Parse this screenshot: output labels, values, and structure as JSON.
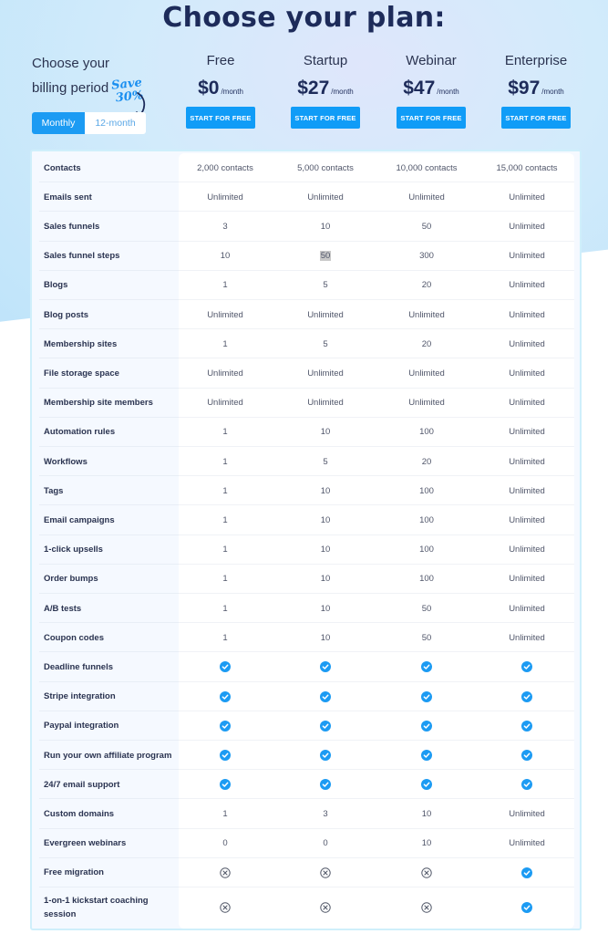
{
  "title": "Choose your plan:",
  "billing": {
    "label_line1": "Choose your",
    "label_line2": "billing period",
    "save_note_line1": "Save",
    "save_note_line2": "30%",
    "options": [
      "Monthly",
      "12-month"
    ],
    "selected": "Monthly"
  },
  "colors": {
    "accent": "#109cf7",
    "heading": "#1d2b5a",
    "check": "#1c9bf3"
  },
  "plans": [
    {
      "name": "Free",
      "price": "$0",
      "period": "/month",
      "button": "START FOR FREE"
    },
    {
      "name": "Startup",
      "price": "$27",
      "period": "/month",
      "button": "START FOR FREE"
    },
    {
      "name": "Webinar",
      "price": "$47",
      "period": "/month",
      "button": "START FOR FREE"
    },
    {
      "name": "Enterprise",
      "price": "$97",
      "period": "/month",
      "button": "START FOR FREE"
    }
  ],
  "features": [
    {
      "label": "Contacts",
      "values": [
        "2,000 contacts",
        "5,000 contacts",
        "10,000 contacts",
        "15,000 contacts"
      ]
    },
    {
      "label": "Emails sent",
      "values": [
        "Unlimited",
        "Unlimited",
        "Unlimited",
        "Unlimited"
      ]
    },
    {
      "label": "Sales funnels",
      "values": [
        "3",
        "10",
        "50",
        "Unlimited"
      ]
    },
    {
      "label": "Sales funnel steps",
      "values": [
        "10",
        "50",
        "300",
        "Unlimited"
      ],
      "selected_cell": 1
    },
    {
      "label": "Blogs",
      "values": [
        "1",
        "5",
        "20",
        "Unlimited"
      ]
    },
    {
      "label": "Blog posts",
      "values": [
        "Unlimited",
        "Unlimited",
        "Unlimited",
        "Unlimited"
      ]
    },
    {
      "label": "Membership sites",
      "values": [
        "1",
        "5",
        "20",
        "Unlimited"
      ]
    },
    {
      "label": "File storage space",
      "values": [
        "Unlimited",
        "Unlimited",
        "Unlimited",
        "Unlimited"
      ]
    },
    {
      "label": "Membership site members",
      "values": [
        "Unlimited",
        "Unlimited",
        "Unlimited",
        "Unlimited"
      ]
    },
    {
      "label": "Automation rules",
      "values": [
        "1",
        "10",
        "100",
        "Unlimited"
      ]
    },
    {
      "label": "Workflows",
      "values": [
        "1",
        "5",
        "20",
        "Unlimited"
      ]
    },
    {
      "label": "Tags",
      "values": [
        "1",
        "10",
        "100",
        "Unlimited"
      ]
    },
    {
      "label": "Email campaigns",
      "values": [
        "1",
        "10",
        "100",
        "Unlimited"
      ]
    },
    {
      "label": "1-click upsells",
      "values": [
        "1",
        "10",
        "100",
        "Unlimited"
      ]
    },
    {
      "label": "Order bumps",
      "values": [
        "1",
        "10",
        "100",
        "Unlimited"
      ]
    },
    {
      "label": "A/B tests",
      "values": [
        "1",
        "10",
        "50",
        "Unlimited"
      ]
    },
    {
      "label": "Coupon codes",
      "values": [
        "1",
        "10",
        "50",
        "Unlimited"
      ]
    },
    {
      "label": "Deadline funnels",
      "values": [
        "check",
        "check",
        "check",
        "check"
      ]
    },
    {
      "label": "Stripe integration",
      "values": [
        "check",
        "check",
        "check",
        "check"
      ]
    },
    {
      "label": "Paypal integration",
      "values": [
        "check",
        "check",
        "check",
        "check"
      ]
    },
    {
      "label": "Run your own affiliate program",
      "values": [
        "check",
        "check",
        "check",
        "check"
      ]
    },
    {
      "label": "24/7 email support",
      "values": [
        "check",
        "check",
        "check",
        "check"
      ]
    },
    {
      "label": "Custom domains",
      "values": [
        "1",
        "3",
        "10",
        "Unlimited"
      ]
    },
    {
      "label": "Evergreen webinars",
      "values": [
        "0",
        "0",
        "10",
        "Unlimited"
      ]
    },
    {
      "label": "Free migration",
      "values": [
        "cross",
        "cross",
        "cross",
        "check"
      ]
    },
    {
      "label": "1-on-1 kickstart coaching session",
      "values": [
        "cross",
        "cross",
        "cross",
        "check"
      ]
    }
  ]
}
